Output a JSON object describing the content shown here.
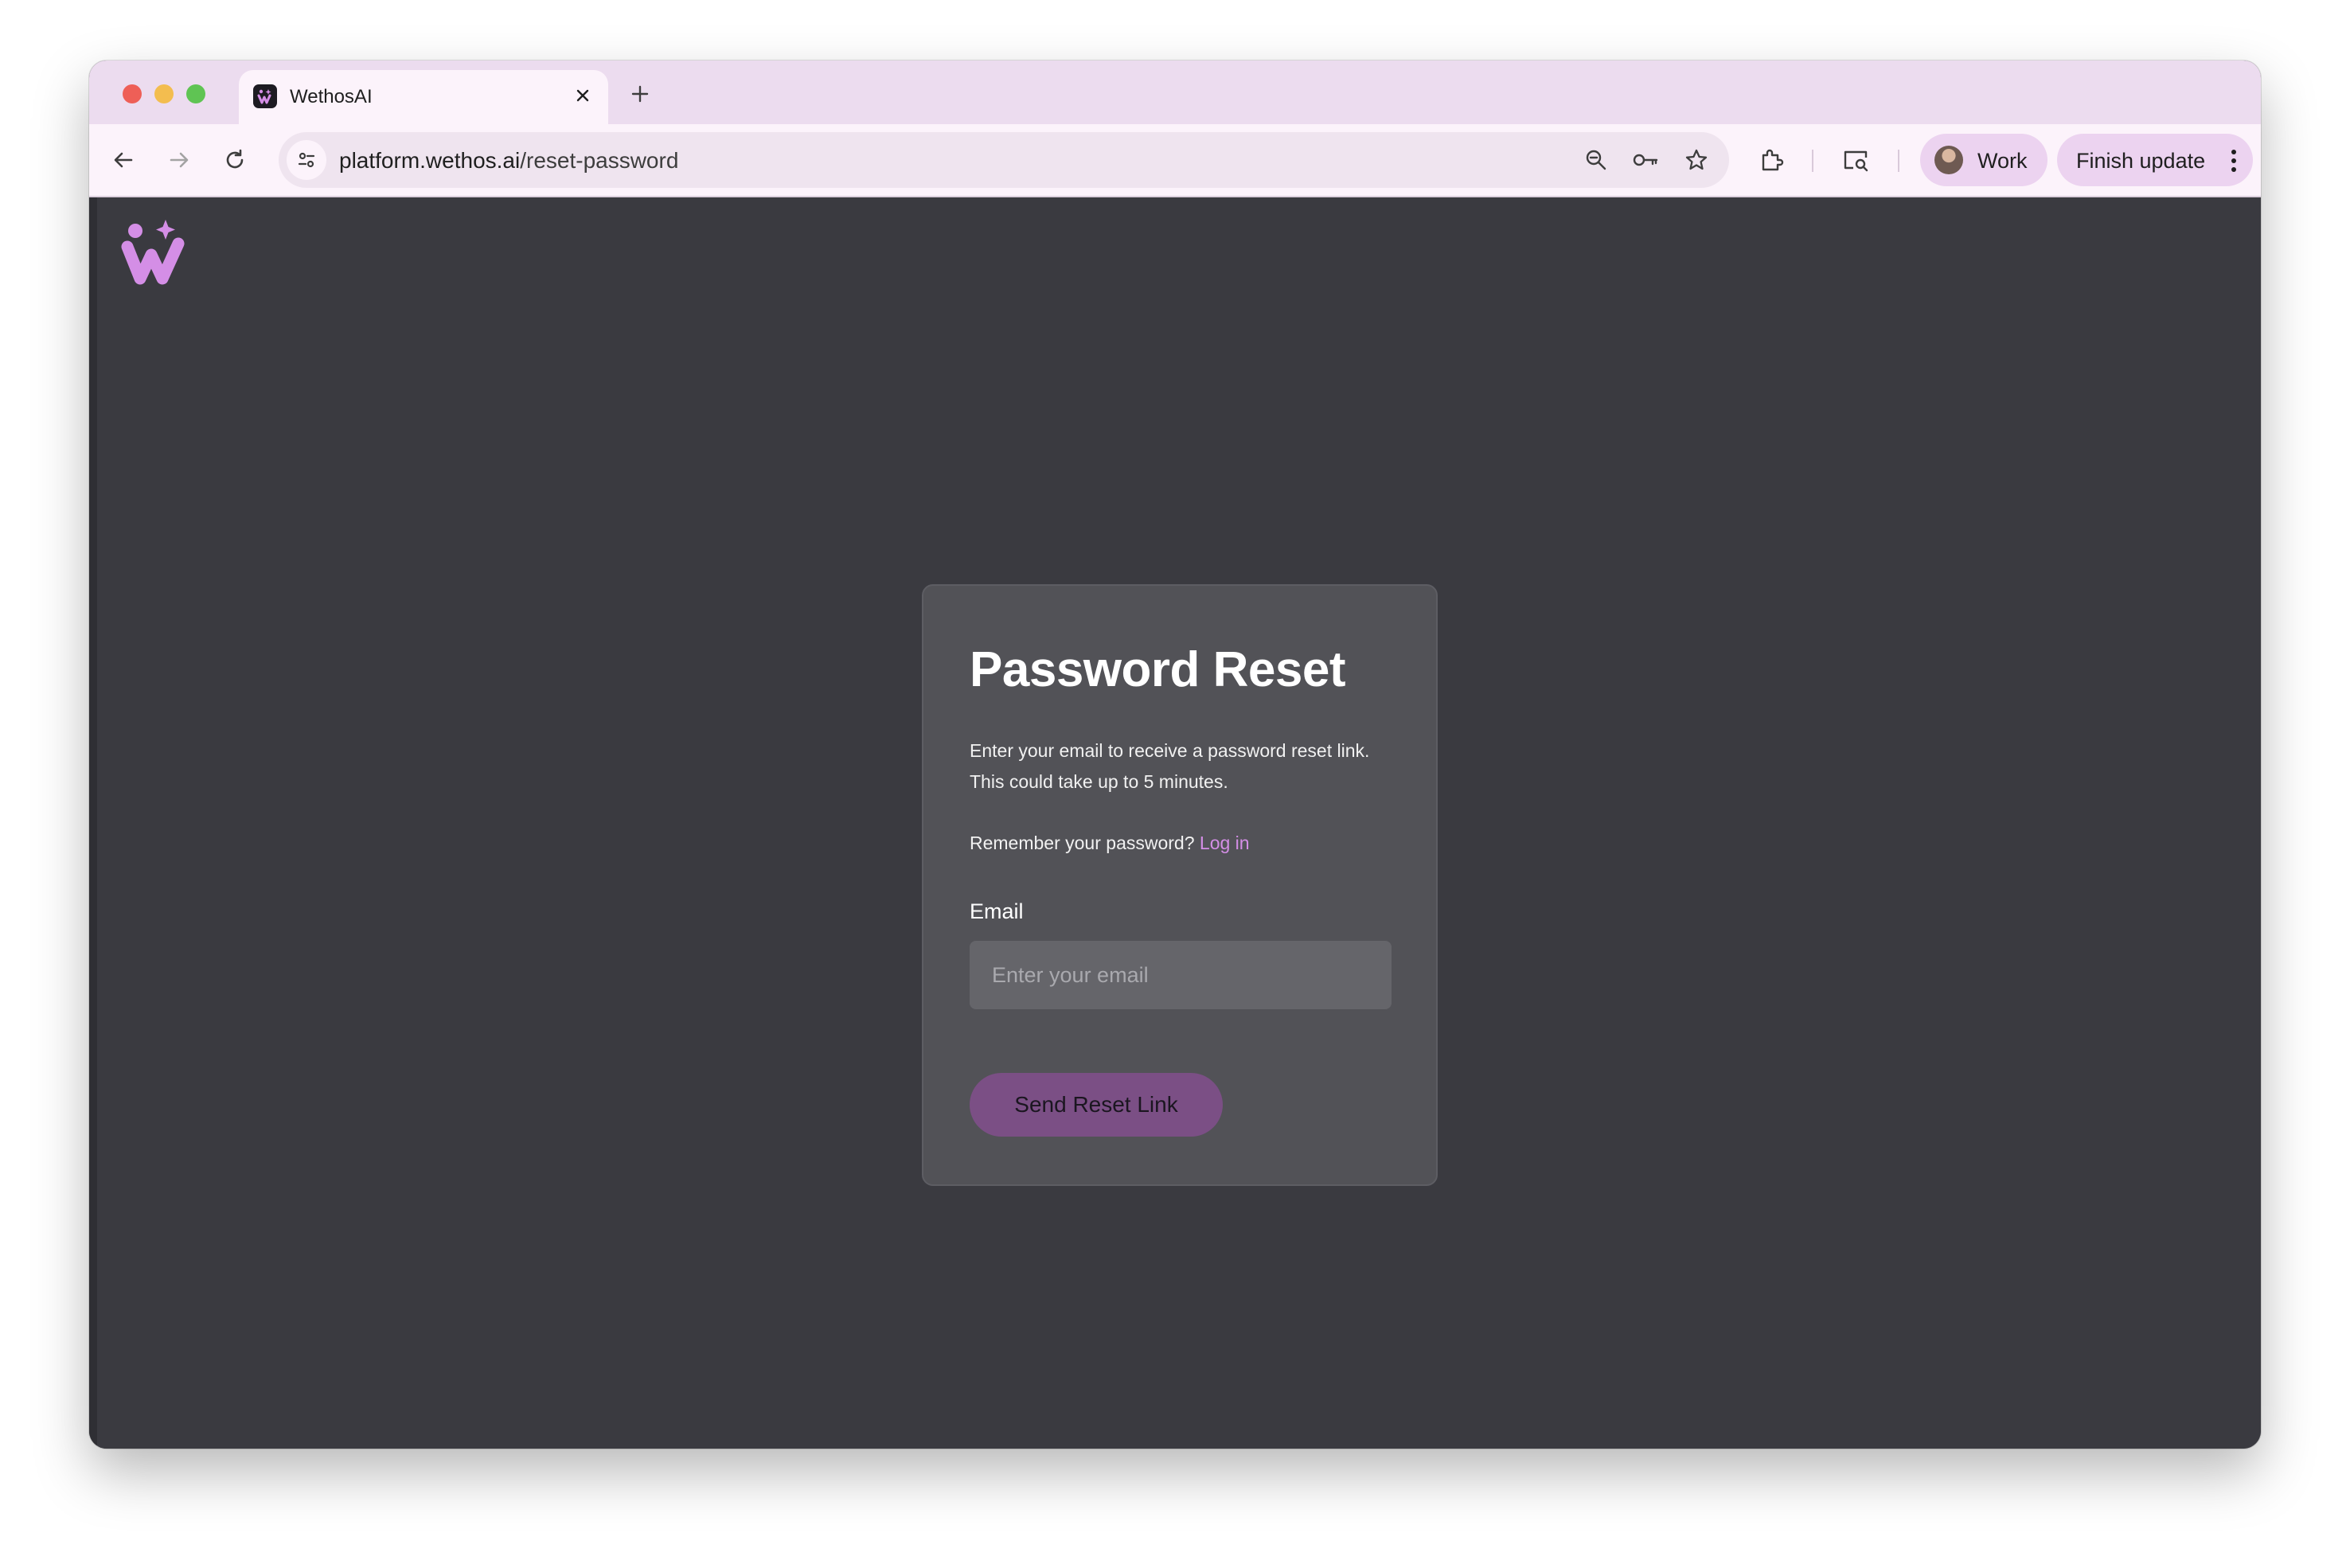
{
  "browser": {
    "tab": {
      "title": "WethosAI",
      "favicon": "wethos-logo-icon"
    },
    "url": {
      "host": "platform.wethos.ai",
      "path": "/reset-password"
    },
    "profile_label": "Work",
    "update_label": "Finish update",
    "icons": [
      "back-arrow-icon",
      "forward-arrow-icon",
      "reload-icon",
      "site-info-icon",
      "zoom-icon",
      "key-icon",
      "star-icon",
      "extensions-icon",
      "cast-icon",
      "more-vertical-icon"
    ]
  },
  "page": {
    "logo": "wethos-logo-icon",
    "title": "Password Reset",
    "description_line1": "Enter your email to receive a password reset link.",
    "description_line2": "This could take up to 5 minutes.",
    "remember_text": "Remember your password?",
    "login_link": "Log in",
    "email_label": "Email",
    "email_placeholder": "Enter your email",
    "email_value": "",
    "submit_label": "Send Reset Link"
  },
  "colors": {
    "page_background": "#3a3a40",
    "card_background": "#525257",
    "accent": "#d48ee6",
    "button": "#7b4f85",
    "tab_strip": "#ecdcef"
  }
}
